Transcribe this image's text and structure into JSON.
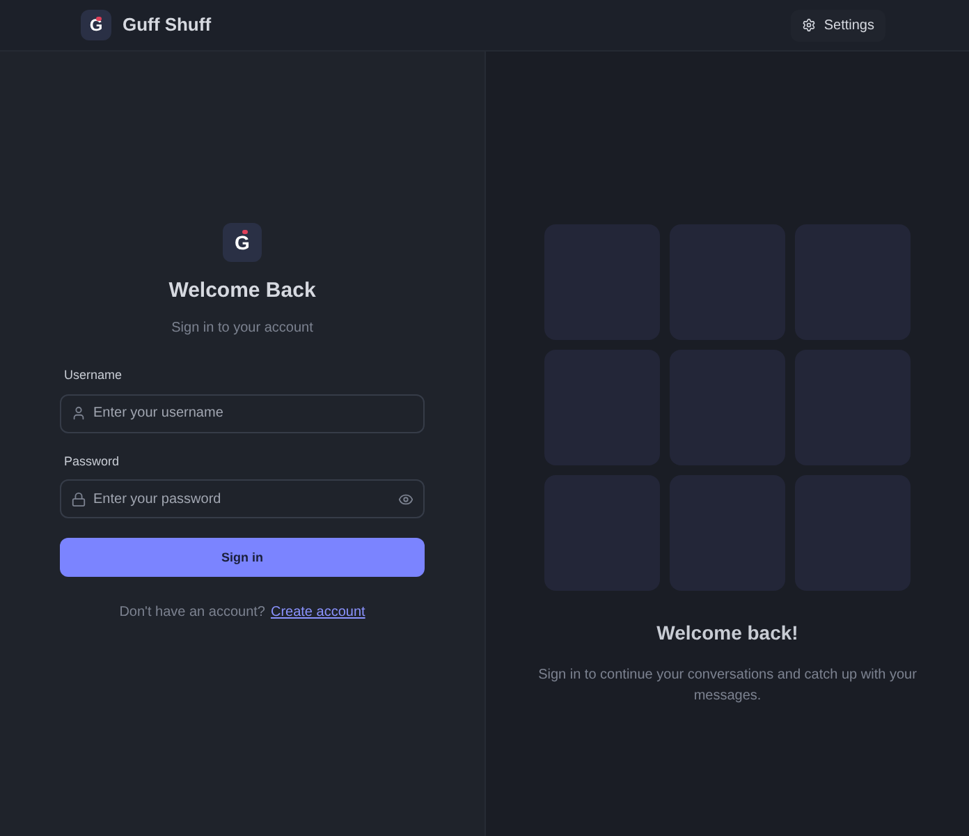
{
  "header": {
    "logo": "G",
    "app_name": "Guff Shuff",
    "settings_button": "Settings"
  },
  "login": {
    "logo": "G",
    "title": "Welcome Back",
    "subtitle": "Sign in to your account",
    "fields": [
      {
        "label": "Username",
        "placeholder": "Enter your username",
        "kind": "user"
      },
      {
        "label": "Password",
        "placeholder": "Enter your password",
        "kind": "password"
      }
    ],
    "submit": "Sign in",
    "footer_text": "Don't have an account?",
    "footer_link": "Create account"
  },
  "aside": {
    "title": "Welcome back!",
    "text": "Sign in to continue your conversations and catch up with your messages."
  }
}
